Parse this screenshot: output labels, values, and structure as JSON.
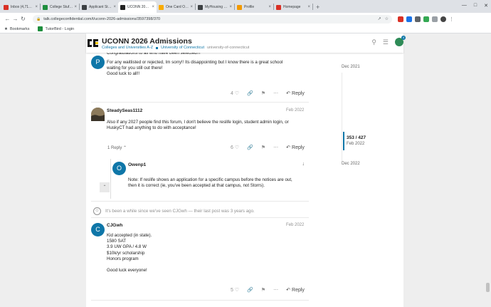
{
  "browser": {
    "tabs": [
      {
        "label": "Inbox (4,717) - dmil",
        "color": "#d93025",
        "icon": "gmail-icon"
      },
      {
        "label": "College Stuff - Goog",
        "color": "#1e8e3e",
        "icon": "sheets-icon"
      },
      {
        "label": "Applicant Status Po",
        "color": "#3c4043",
        "icon": "portal-icon"
      },
      {
        "label": "UCONN 2026 Admis",
        "color": "#222222",
        "icon": "cc-icon",
        "active": true
      },
      {
        "label": "One Card Office",
        "color": "#f9ab00",
        "icon": "onecard-icon"
      },
      {
        "label": "MyHousing | Resid",
        "color": "#3c4043",
        "icon": "housing-icon"
      },
      {
        "label": "Profile",
        "color": "#f29900",
        "icon": "profile-icon"
      },
      {
        "label": "Homepage",
        "color": "#d93025",
        "icon": "homepage-icon"
      }
    ],
    "url": "talk.collegeconfidential.com/t/uconn-2026-admissions/3597398/370",
    "bookmarks": [
      {
        "label": "Bookmarks",
        "icon": "bookmarks-icon"
      },
      {
        "label": "TutorBird - Login",
        "icon": "tutorbird-icon"
      }
    ]
  },
  "site": {
    "title": "UCONN 2026 Admissions",
    "category1": "Colleges and Universities A-Z",
    "category2": "University of Connecticut",
    "tag": "university-of-connecticut",
    "notif_count": "4"
  },
  "posts": {
    "p1": {
      "avatar_letter": "P",
      "avatar_color": "#0e76a8",
      "text_top": "Congratulations to all who have been selected!!!",
      "lines": [
        "For any waitlisted or rejected, Im sorry!! Its disappointing but I know there is a great school",
        "waiting for you still out there!",
        "Good luck to all!!"
      ],
      "likes": "4",
      "reply_label": "Reply"
    },
    "p2": {
      "username": "SteadySeas1112",
      "date": "Feb 2022",
      "lines": [
        "Also if any 2027 people find this forum, I don't believe the reslife login, student admin login, or",
        "HuskyCT had anything to do with acceptance!"
      ],
      "replies_link": "1 Reply",
      "likes": "6",
      "reply_label": "Reply"
    },
    "embedded": {
      "avatar_letter": "O",
      "avatar_color": "#0e76a8",
      "username": "Owenp1",
      "lines": [
        "Note: If reslife shows an application for a specific campus before the notices are out,",
        "then it is correct (ie, you've been accepted at that campus, not Storrs)."
      ]
    },
    "gap_note": "It's been a while since we've seen CJGwh — their last post was 3 years ago.",
    "p3": {
      "avatar_letter": "C",
      "avatar_color": "#0e76a8",
      "username": "CJGwh",
      "date": "Feb 2022",
      "lines": [
        "Kid accepted (in state).",
        "1580 SAT",
        "3.9 UW GPA / 4.8 W",
        "$10k/yr scholarship",
        "Honors program",
        "",
        "Good luck everyone!"
      ],
      "likes": "5",
      "reply_label": "Reply"
    }
  },
  "timeline": {
    "top_date": "Dec 2021",
    "count": "353 / 427",
    "count_date": "Feb 2022",
    "bottom_date": "Dec 2022"
  }
}
